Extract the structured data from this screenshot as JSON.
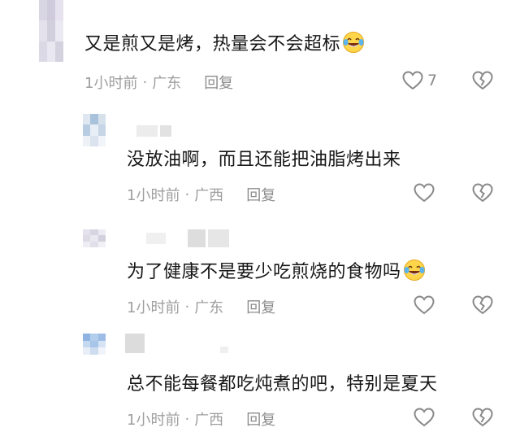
{
  "comments": [
    {
      "text": "又是煎又是烤，热量会不会超标",
      "time": "1小时前",
      "location": "广东",
      "reply_label": "回复",
      "likes": "7",
      "has_emoji": true
    },
    {
      "text": "没放油啊，而且还能把油脂烤出来",
      "time": "1小时前",
      "location": "广西",
      "reply_label": "回复",
      "likes": "",
      "has_emoji": false
    },
    {
      "text": "为了健康不是要少吃煎烧的食物吗",
      "time": "1小时前",
      "location": "广东",
      "reply_label": "回复",
      "likes": "",
      "has_emoji": true
    },
    {
      "text": "总不能每餐都吃炖煮的吧，特别是夏天",
      "time": "1小时前",
      "location": "广西",
      "reply_label": "回复",
      "likes": "",
      "has_emoji": false
    }
  ],
  "separator": "·",
  "icons": {
    "like": "heart-outline-icon",
    "dislike": "broken-heart-icon",
    "emoji": "laughing-tears-emoji"
  },
  "colors": {
    "text": "#161616",
    "meta": "#9e9e9e",
    "icon": "#8a8a8a"
  }
}
